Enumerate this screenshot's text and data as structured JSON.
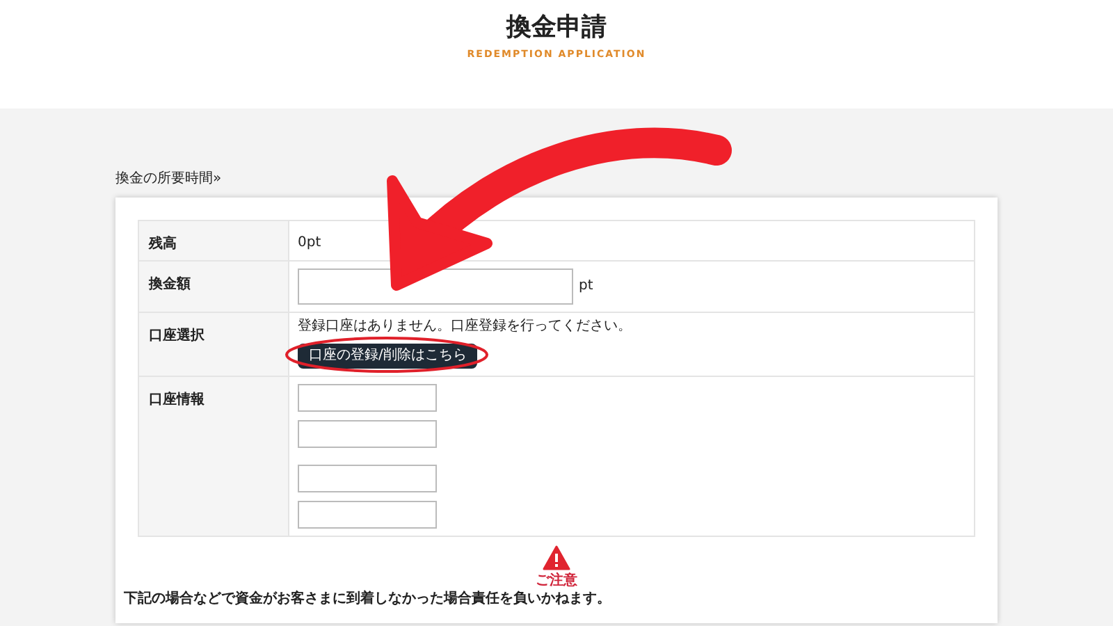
{
  "header": {
    "title": "換金申請",
    "subtitle": "REDEMPTION APPLICATION"
  },
  "time_link": "換金の所要時間»",
  "form": {
    "rows": [
      {
        "kind": "text",
        "label": "残高",
        "value": "0pt"
      },
      {
        "kind": "amount",
        "label": "換金額",
        "unit": "pt"
      },
      {
        "kind": "account",
        "label": "口座選択",
        "message": "登録口座はありません。口座登録を行ってください。",
        "button": "口座の登録/削除はこちら"
      },
      {
        "kind": "fields",
        "label": "口座情報"
      }
    ]
  },
  "notice": {
    "title": "ご注意",
    "text": "下記の場合などで資金がお客さまに到着しなかった場合責任を負いかねます。"
  }
}
